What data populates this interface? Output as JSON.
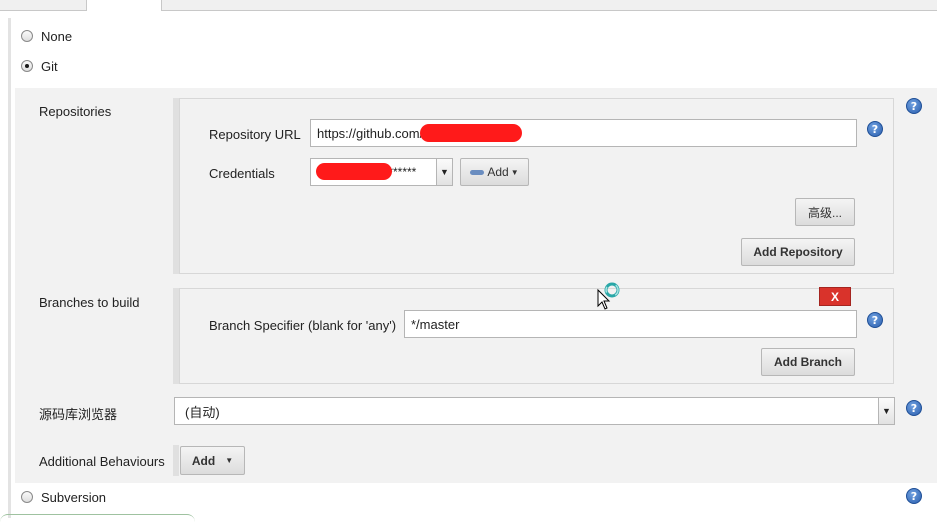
{
  "scm": {
    "options": [
      {
        "label": "None",
        "checked": false
      },
      {
        "label": "Git",
        "checked": true
      },
      {
        "label": "Subversion",
        "checked": false
      }
    ]
  },
  "git": {
    "repositories_label": "Repositories",
    "repo_url_label": "Repository URL",
    "repo_url_value": "https://github.com/",
    "credentials_label": "Credentials",
    "credentials_value": "/******",
    "add_label": "Add",
    "advanced_label": "高级...",
    "add_repository_label": "Add Repository",
    "branches_label": "Branches to build",
    "branch_specifier_label": "Branch Specifier (blank for 'any')",
    "branch_specifier_value": "*/master",
    "delete_label": "X",
    "add_branch_label": "Add Branch",
    "browser_label": "源码库浏览器",
    "browser_value": "(自动)",
    "additional_label": "Additional Behaviours",
    "additional_add_label": "Add"
  },
  "help_glyph": "?",
  "colors": {
    "redaction": "#ff1a1a",
    "delete_button": "#d9332b",
    "help_icon": "#2b5fae"
  }
}
